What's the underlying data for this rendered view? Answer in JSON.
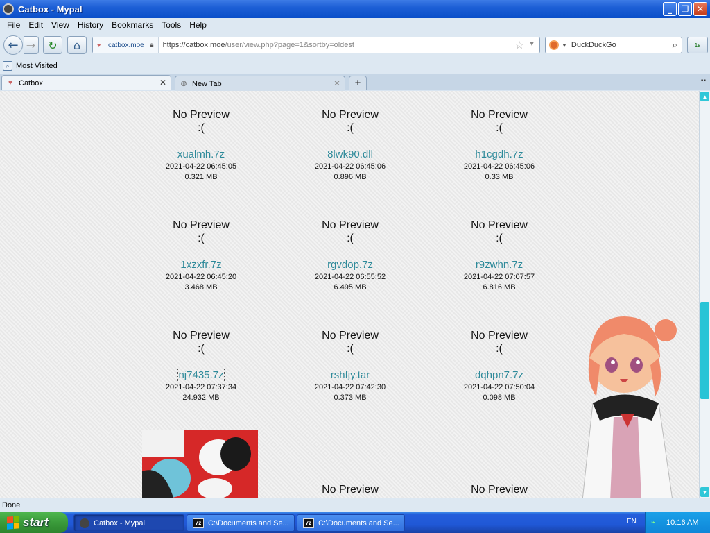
{
  "window": {
    "title": "Catbox - Mypal",
    "minimize_icon": "minimize-icon",
    "maximize_icon": "restore-icon",
    "close_icon": "close-icon"
  },
  "menu": [
    "File",
    "Edit",
    "View",
    "History",
    "Bookmarks",
    "Tools",
    "Help"
  ],
  "nav": {
    "identity_domain": "catbox.moe",
    "url_prefix": "https://catbox.moe",
    "url_path": "/user/view.php?page=1&sortby=oldest",
    "search_placeholder": "DuckDuckGo",
    "addon_label": "1s"
  },
  "bookmarks": {
    "most_visited": "Most Visited"
  },
  "tabs": [
    {
      "label": "Catbox"
    },
    {
      "label": "New Tab"
    }
  ],
  "content": {
    "no_preview": "No Preview",
    "sad_face": ":(",
    "files": [
      {
        "name": "xualmh.7z",
        "date": "2021-04-22 06:45:05",
        "size": "0.321 MB"
      },
      {
        "name": "8lwk90.dll",
        "date": "2021-04-22 06:45:06",
        "size": "0.896 MB"
      },
      {
        "name": "h1cgdh.7z",
        "date": "2021-04-22 06:45:06",
        "size": "0.33 MB"
      },
      {
        "name": "1xzxfr.7z",
        "date": "2021-04-22 06:45:20",
        "size": "3.468 MB"
      },
      {
        "name": "rgvdop.7z",
        "date": "2021-04-22 06:55:52",
        "size": "6.495 MB"
      },
      {
        "name": "r9zwhn.7z",
        "date": "2021-04-22 07:07:57",
        "size": "6.816 MB"
      },
      {
        "name": "nj7435.7z",
        "date": "2021-04-22 07:37:34",
        "size": "24.932 MB"
      },
      {
        "name": "rshfjy.tar",
        "date": "2021-04-22 07:42:30",
        "size": "0.373 MB"
      },
      {
        "name": "dqhpn7.7z",
        "date": "2021-04-22 07:50:04",
        "size": "0.098 MB"
      }
    ]
  },
  "status": {
    "text": "Done"
  },
  "taskbar": {
    "start": "start",
    "items": [
      "Catbox - Mypal",
      "C:\\Documents and Se...",
      "C:\\Documents and Se..."
    ],
    "language": "EN",
    "clock": "10:16 AM"
  },
  "colors": {
    "link": "#2e8a9a",
    "scrollbar_accent": "#29c4d6",
    "taskbar": "#245edb"
  }
}
